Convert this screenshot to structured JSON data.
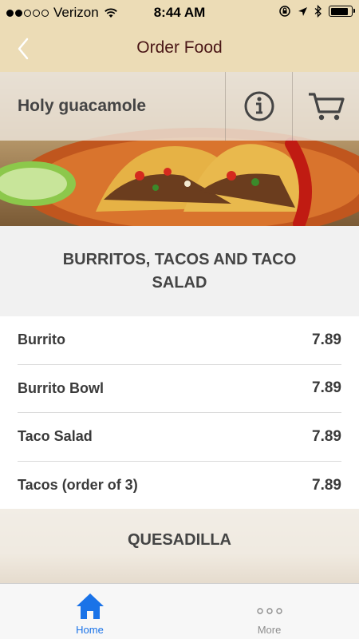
{
  "status_bar": {
    "carrier": "Verizon",
    "time": "8:44 AM",
    "signal_bars_filled": 2,
    "signal_bars_total": 5,
    "battery_level": 0.85
  },
  "nav": {
    "title": "Order Food",
    "back_icon": "chevron-left-icon"
  },
  "restaurant": {
    "name": "Holy guacamole",
    "info_icon": "info-icon",
    "cart_icon": "cart-icon"
  },
  "sections": [
    {
      "title": "BURRITOS, TACOS AND TACO SALAD",
      "items": [
        {
          "name": "Burrito",
          "price": "7.89"
        },
        {
          "name": "Burrito Bowl",
          "price": "7.89"
        },
        {
          "name": "Taco Salad",
          "price": "7.89"
        },
        {
          "name": "Tacos (order of 3)",
          "price": "7.89"
        }
      ]
    },
    {
      "title": "QUESADILLA"
    }
  ],
  "tabs": [
    {
      "label": "Home",
      "icon": "home-icon",
      "active": true
    },
    {
      "label": "More",
      "icon": "more-icon",
      "active": false
    }
  ],
  "colors": {
    "header_bg": "#ecdcb6",
    "title_text": "#4a1616",
    "active_tab": "#1a73e8",
    "inactive_tab": "#8e8e8e"
  }
}
